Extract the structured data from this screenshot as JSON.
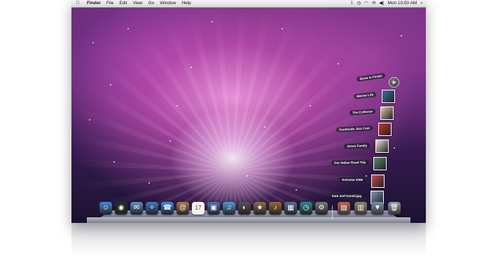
{
  "menubar": {
    "apple_icon": "apple-icon",
    "app_name": "Finder",
    "menus": [
      "File",
      "Edit",
      "View",
      "Go",
      "Window",
      "Help"
    ],
    "status_icons": [
      "bluetooth-icon",
      "time-machine-icon",
      "wifi-icon",
      "sync-icon",
      "volume-icon"
    ],
    "clock": "Mon 10:50 AM",
    "spotlight_icon": "spotlight-icon"
  },
  "stack": {
    "show_in_finder": "Show in Finder",
    "items": [
      {
        "label": "Marine Life",
        "thumb_color": "#3d6fa8"
      },
      {
        "label": "The Collector",
        "thumb_color": "#d9c9a6"
      },
      {
        "label": "Southside Jazz Fest",
        "thumb_color": "#c23a2b"
      },
      {
        "label": "Jones Family",
        "thumb_color": "#e8e2d4"
      },
      {
        "label": "Our Italian Road Trip",
        "thumb_color": "#5a8a6a"
      },
      {
        "label": "Extreme 2008",
        "thumb_color": "#c94a4a"
      },
      {
        "label": "Sam and Daniel.jpg",
        "thumb_color": "#7d9cc0"
      }
    ]
  },
  "dock": {
    "apps": [
      {
        "name": "finder-icon",
        "glyph": "☺",
        "color": "#4a88d8"
      },
      {
        "name": "dashboard-icon",
        "glyph": "◉",
        "color": "#2a2a2a"
      },
      {
        "name": "mail-icon",
        "glyph": "✉",
        "color": "#5a90c8"
      },
      {
        "name": "safari-icon",
        "glyph": "✧",
        "color": "#3a7ac0"
      },
      {
        "name": "ichat-icon",
        "glyph": "☎",
        "color": "#3b8ee0"
      },
      {
        "name": "address-book-icon",
        "glyph": "@",
        "color": "#b07a40"
      },
      {
        "name": "ical-icon",
        "glyph": "17",
        "color": "#f2f2f2"
      },
      {
        "name": "iphoto-icon",
        "glyph": "▣",
        "color": "#4a78b0"
      },
      {
        "name": "itunes-icon",
        "glyph": "♫",
        "color": "#4aa0d8"
      },
      {
        "name": "photo-booth-icon",
        "glyph": "◐",
        "color": "#555"
      },
      {
        "name": "imovie-icon",
        "glyph": "★",
        "color": "#8a7040"
      },
      {
        "name": "garageband-icon",
        "glyph": "♪",
        "color": "#9a6a30"
      },
      {
        "name": "spaces-icon",
        "glyph": "▦",
        "color": "#5a7090"
      },
      {
        "name": "time-machine-icon",
        "glyph": "◷",
        "color": "#2a8a8a"
      },
      {
        "name": "system-preferences-icon",
        "glyph": "⚙",
        "color": "#7a7a7a"
      }
    ],
    "stacks": [
      {
        "name": "pictures-stack-icon",
        "glyph": "▤",
        "color": "#c06050"
      },
      {
        "name": "documents-stack-icon",
        "glyph": "▥",
        "color": "#8a8a6a"
      },
      {
        "name": "downloads-stack-icon",
        "glyph": "▼",
        "color": "#7a8fa8"
      },
      {
        "name": "trash-icon",
        "glyph": "🗑",
        "color": "#9a9aa0"
      }
    ]
  },
  "colors": {
    "menubar_bg": "#e2e2e2",
    "wallpaper_accent": "#d86ac8"
  }
}
